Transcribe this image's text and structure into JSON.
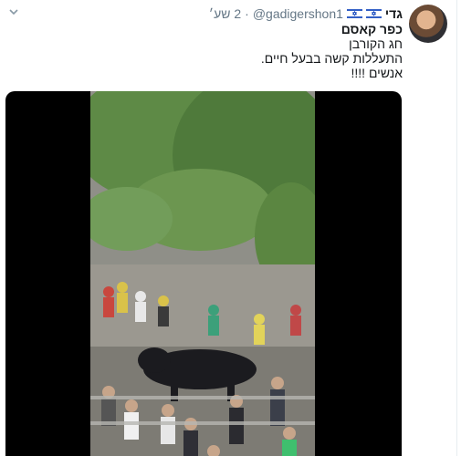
{
  "tweet": {
    "display_name": "גדי",
    "handle": "@gadigershon1",
    "separator": "·",
    "time": "2 שע׳",
    "lines": [
      "כפר קאסם",
      "חג הקורבן",
      "התעללות קשה בבעל חיים.",
      "אנשים !!!!"
    ]
  },
  "icons": {
    "flag": "israel-flag-icon",
    "caret": "chevron-down-icon",
    "avatar": "profile-avatar"
  },
  "colors": {
    "text": "#14171a",
    "secondary": "#657786",
    "flag_blue": "#0038b8"
  }
}
